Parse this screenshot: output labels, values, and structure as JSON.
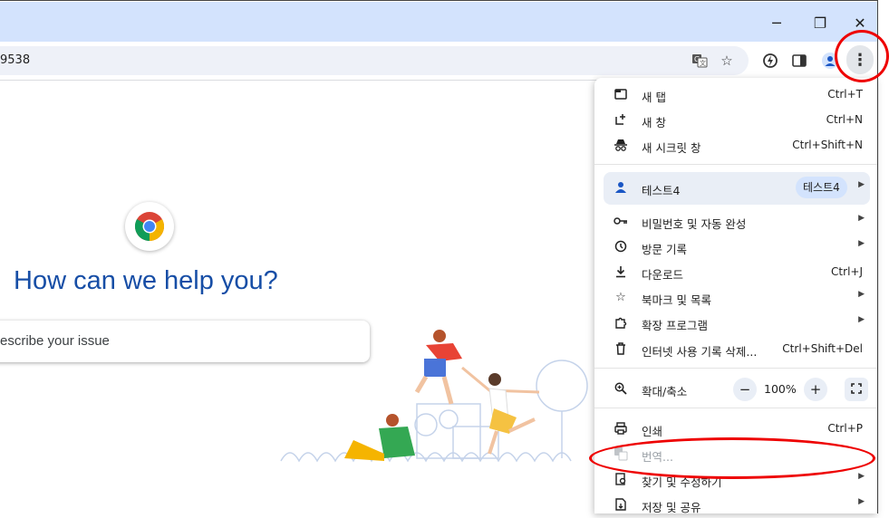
{
  "window": {
    "minimize": "─",
    "restore": "❐",
    "close": "✕"
  },
  "toolbar": {
    "url_fragment": "9538"
  },
  "page": {
    "headline": "How can we help you?",
    "issue_placeholder": "escribe your issue"
  },
  "menu": {
    "new_tab": {
      "label": "새 탭",
      "shortcut": "Ctrl+T"
    },
    "new_window": {
      "label": "새 창",
      "shortcut": "Ctrl+N"
    },
    "incognito": {
      "label": "새 시크릿 창",
      "shortcut": "Ctrl+Shift+N"
    },
    "profile": {
      "label": "테스트4",
      "badge": "테스트4"
    },
    "passwords": {
      "label": "비밀번호 및 자동 완성"
    },
    "history": {
      "label": "방문 기록"
    },
    "downloads": {
      "label": "다운로드",
      "shortcut": "Ctrl+J"
    },
    "bookmarks": {
      "label": "북마크 및 목록"
    },
    "extensions": {
      "label": "확장 프로그램"
    },
    "clear_data": {
      "label": "인터넷 사용 기록 삭제...",
      "shortcut": "Ctrl+Shift+Del"
    },
    "zoom": {
      "label": "확대/축소",
      "value": "100%",
      "minus": "−",
      "plus": "+"
    },
    "print": {
      "label": "인쇄",
      "shortcut": "Ctrl+P"
    },
    "translate": {
      "label": "번역..."
    },
    "find_edit": {
      "label": "찾기 및 수정하기"
    },
    "save_share": {
      "label": "저장 및 공유"
    }
  },
  "colors": {
    "accent": "#174ea6",
    "titlebar": "#d3e3fd",
    "annotation": "#e00000"
  }
}
